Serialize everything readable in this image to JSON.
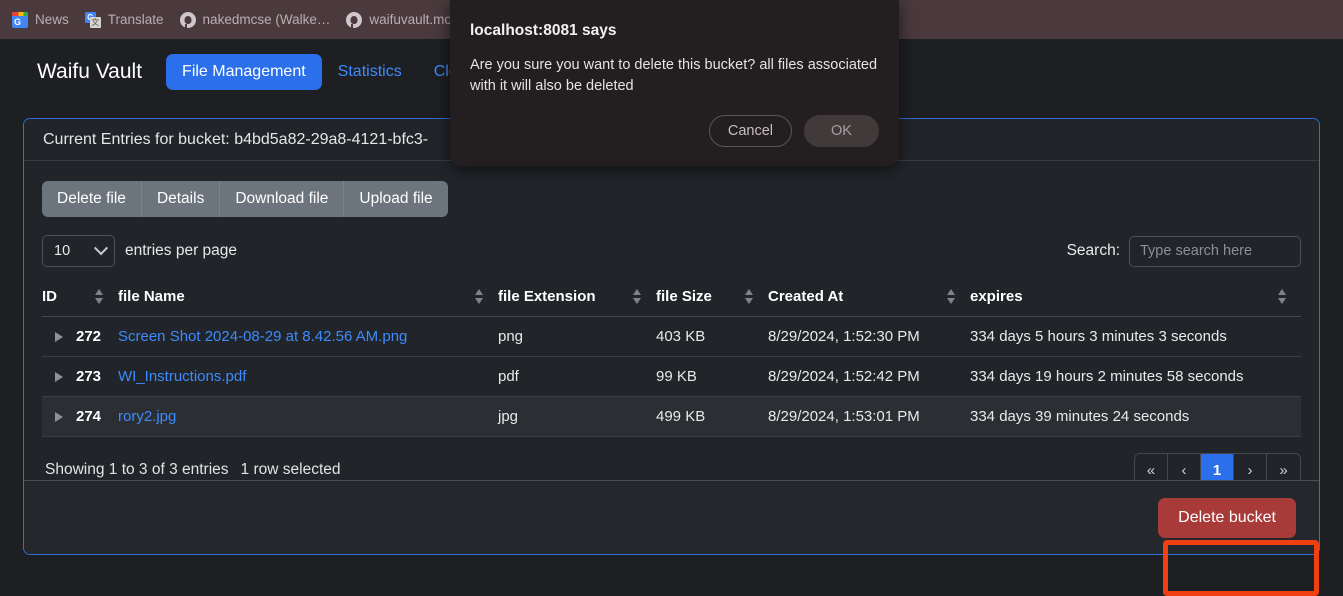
{
  "browser": {
    "bookmarks": [
      {
        "label": "News",
        "icon": "google-news-icon"
      },
      {
        "label": "Translate",
        "icon": "google-translate-icon"
      },
      {
        "label": "nakedmcse (Walke…",
        "icon": "github-icon"
      },
      {
        "label": "waifuvault.moe",
        "icon": "github-icon"
      },
      {
        "label": "",
        "icon": "github-icon"
      }
    ]
  },
  "navbar": {
    "brand": "Waifu Vault",
    "links": [
      {
        "label": "File Management",
        "active": true
      },
      {
        "label": "Statistics",
        "active": false
      },
      {
        "label": "Clo",
        "active": false
      }
    ]
  },
  "card": {
    "header": "Current Entries for bucket: b4bd5a82-29a8-4121-bfc3-",
    "toolbar": [
      "Delete file",
      "Details",
      "Download file",
      "Upload file"
    ],
    "page_length": {
      "value": "10",
      "label": "entries per page",
      "chevron": "chevron-down-icon"
    },
    "search": {
      "label": "Search:",
      "value": "",
      "placeholder": "Type search here"
    },
    "table": {
      "columns": [
        "ID",
        "file Name",
        "file Extension",
        "file Size",
        "Created At",
        "expires"
      ],
      "rows": [
        {
          "id": "272",
          "name": "Screen Shot 2024-08-29 at 8.42.56 AM.png",
          "ext": "png",
          "size": "403 KB",
          "created": "8/29/2024, 1:52:30 PM",
          "expires": "334 days 5 hours 3 minutes 3 seconds",
          "selected": false
        },
        {
          "id": "273",
          "name": "WI_Instructions.pdf",
          "ext": "pdf",
          "size": "99 KB",
          "created": "8/29/2024, 1:52:42 PM",
          "expires": "334 days 19 hours 2 minutes 58 seconds",
          "selected": false
        },
        {
          "id": "274",
          "name": "rory2.jpg",
          "ext": "jpg",
          "size": "499 KB",
          "created": "8/29/2024, 1:53:01 PM",
          "expires": "334 days 39 minutes 24 seconds",
          "selected": true
        }
      ]
    },
    "footer": {
      "showing": "Showing 1 to 3 of 3 entries",
      "selection": "1 row selected",
      "pagination": {
        "first": "«",
        "prev": "‹",
        "current": "1",
        "next": "›",
        "last": "»"
      }
    },
    "delete_bucket_label": "Delete bucket"
  },
  "dialog": {
    "title": "localhost:8081 says",
    "message": "Are you sure you want to delete this bucket? all files associated with it will also be deleted",
    "cancel_label": "Cancel",
    "ok_label": "OK"
  },
  "colors": {
    "accent_blue": "#2b70ea",
    "link_blue": "#3d8bfd",
    "danger_red": "#a93a3a",
    "focus_ring": "#f03f10",
    "bookmarks_bar": "#4a3a3e"
  }
}
